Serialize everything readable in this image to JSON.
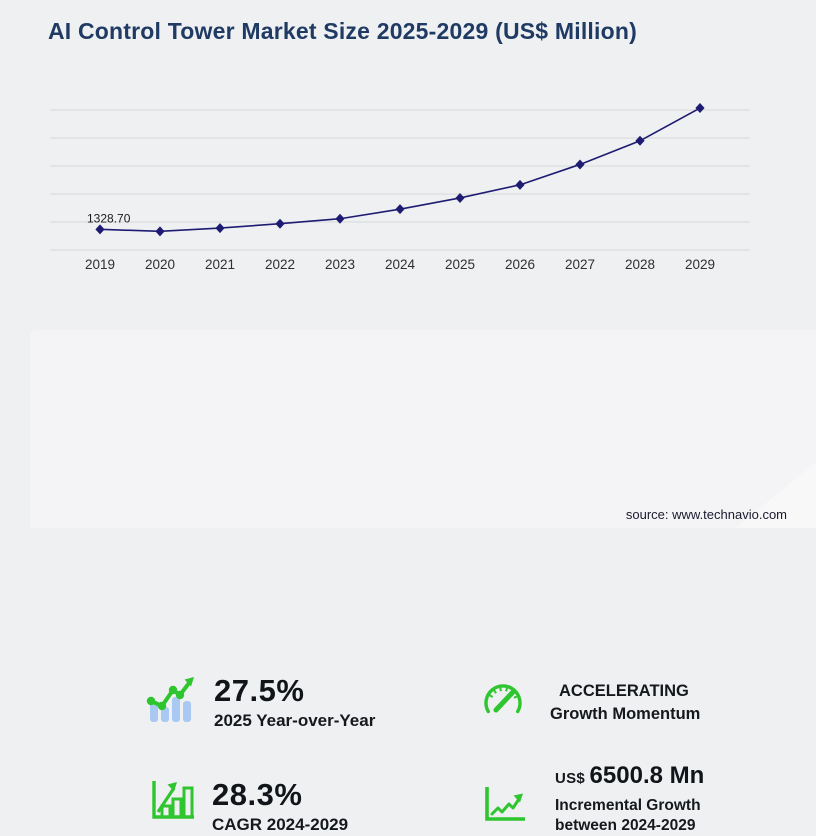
{
  "page": {
    "title": "AI Control Tower Market Size 2025-2029 (US$ Million)",
    "source": "source: www.technavio.com"
  },
  "chart_data": {
    "type": "line",
    "title": "AI Control Tower Market Size 2025-2029 (US$ Million)",
    "x": [
      "2019",
      "2020",
      "2021",
      "2022",
      "2023",
      "2024",
      "2025",
      "2026",
      "2027",
      "2028",
      "2029"
    ],
    "series": [
      {
        "name": "AI Control Tower Market Size (US$ Million)",
        "values": [
          1328.7,
          1200,
          1410,
          1690,
          2010,
          2624.5,
          3346.2,
          4190,
          5500,
          7020,
          9125.3
        ]
      }
    ],
    "data_labels": [
      {
        "x": "2019",
        "label": "1328.70"
      }
    ],
    "ylim": [
      0,
      9000
    ],
    "gridline_count": 6,
    "grid": "horizontal",
    "legend": "none",
    "marker": "diamond"
  },
  "stats": {
    "yoy": {
      "icon": "bar-chart-trend-icon",
      "value": "27.5%",
      "label": "2025 Year-over-Year"
    },
    "momentum": {
      "icon": "speedometer-icon",
      "line1": "ACCELERATING",
      "line2": "Growth Momentum"
    },
    "cagr": {
      "icon": "growth-bars-icon",
      "value": "28.3%",
      "label": "CAGR 2024-2029"
    },
    "incremental": {
      "icon": "line-growth-icon",
      "currency": "US$",
      "value": "6500.8 Mn",
      "label_line1": "Incremental Growth",
      "label_line2": "between 2024-2029"
    }
  },
  "colors": {
    "page_bg": "#eff0f2",
    "panel_bg": "#f4f4f6",
    "title_navy": "#1f3a63",
    "line_navy": "#1e1c72",
    "grid_gray": "#d6d7da",
    "accent_green": "#2fc52f",
    "bar_blue": "#a9c9f2"
  }
}
